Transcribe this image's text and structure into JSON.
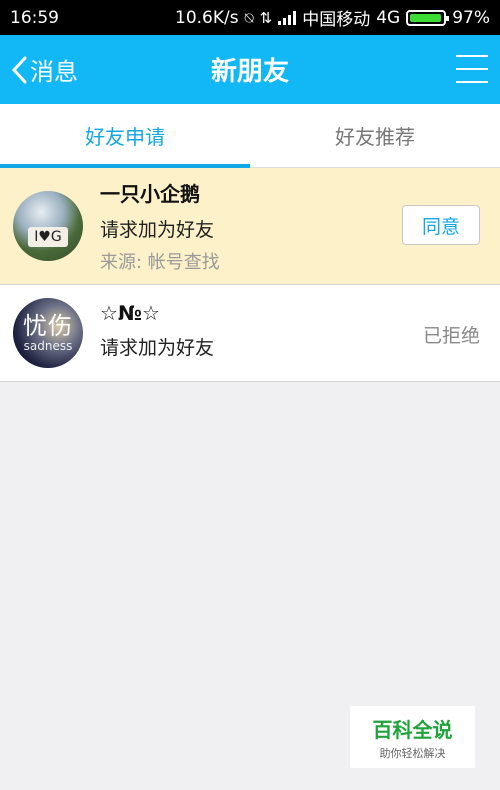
{
  "status_bar": {
    "time": "16:59",
    "speed": "10.6K/s",
    "carrier": "中国移动",
    "network": "4G",
    "battery": "97%",
    "battery_level": 0.97
  },
  "header": {
    "back_label": "消息",
    "title": "新朋友"
  },
  "tabs": [
    {
      "label": "好友申请",
      "active": true
    },
    {
      "label": "好友推荐",
      "active": false
    }
  ],
  "requests": [
    {
      "name": "一只小企鹅",
      "message": "请求加为好友",
      "source": "来源: 帐号查找",
      "action_label": "同意",
      "avatar_text": "I♥G"
    },
    {
      "name": "☆№☆",
      "message": "请求加为好友",
      "status": "已拒绝",
      "avatar_text_big": "忧伤",
      "avatar_text_small": "sadness"
    }
  ],
  "watermark": {
    "title": "百科全说",
    "subtitle": "助你轻松解决"
  }
}
